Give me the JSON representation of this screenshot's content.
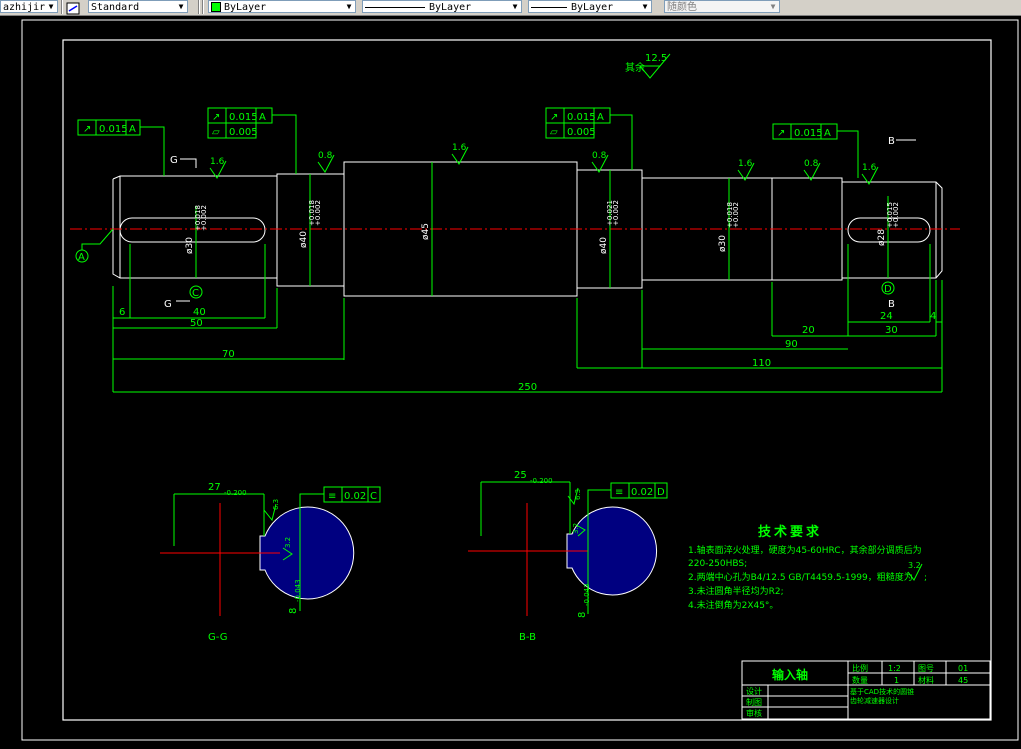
{
  "toolbar": {
    "text_style": "azhijir",
    "dim_style": "Standard",
    "layer_color": "ByLayer",
    "linetype": "ByLayer",
    "lineweight": "ByLayer",
    "plot_style": "随颜色",
    "layer_swatch_color": "#00ff00"
  },
  "drawing": {
    "surface_finish_note": "其余",
    "surface_finish_value": "12.5",
    "shaft": {
      "tolerance_frames": [
        {
          "symbol": "↗",
          "value": "0.015",
          "datum": "A"
        },
        {
          "symbol": "↗",
          "value": "0.015",
          "datum": "A"
        },
        {
          "symbol": "▱",
          "value": "0.005",
          "datum": ""
        },
        {
          "symbol": "↗",
          "value": "0.015",
          "datum": "A"
        },
        {
          "symbol": "▱",
          "value": "0.005",
          "datum": ""
        },
        {
          "symbol": "↗",
          "value": "0.015",
          "datum": "A"
        }
      ],
      "roughness_marks": [
        "1.6",
        "0.8",
        "1.6",
        "0.8",
        "1.6",
        "0.8",
        "1.6"
      ],
      "diameters": [
        "ø30",
        "ø40",
        "ø45",
        "ø40",
        "ø30",
        "ø28"
      ],
      "diameter_tolerances": [
        "+0.018\n+0.002",
        "+0.018\n+0.002",
        "",
        "+0.021\n+0.002",
        "+0.018\n+0.002",
        "+0.015\n+0.002"
      ],
      "section_labels": {
        "G": "G",
        "B": "B"
      },
      "datum_labels": [
        "A",
        "C",
        "D"
      ],
      "dimensions": [
        "6",
        "40",
        "50",
        "70",
        "250",
        "110",
        "90",
        "20",
        "24",
        "30",
        "4"
      ]
    },
    "sections": [
      {
        "label": "G-G",
        "width": "27",
        "width_tol": "-0.200",
        "key_depth": "8",
        "key_tol": "-0.043",
        "tol_value": "0.02",
        "tol_datum": "C",
        "rough1": "6.3",
        "rough2": "3.2"
      },
      {
        "label": "B-B",
        "width": "25",
        "width_tol": "-0.200",
        "key_depth": "8",
        "key_tol": "-0.043",
        "tol_value": "0.02",
        "tol_datum": "D",
        "rough1": "6.3",
        "rough2": "3.2"
      }
    ],
    "tech_requirements": {
      "title": "技术要求",
      "items": [
        "1.轴表面淬火处理，硬度为45-60HRC，其余部分调质后为",
        "220-250HBS;",
        "2.两端中心孔为B4/12.5 GB/T4459.5-1999，粗糙度为",
        "3.未注圆角半径均为R2;",
        "4.未注倒角为2X45°。"
      ],
      "roughness_mark": "3.2"
    },
    "title_block": {
      "part_name": "输入轴",
      "scale_label": "比例",
      "scale_value": "1:2",
      "qty_label": "数量",
      "qty_value": "1",
      "drawing_no_label": "图号",
      "drawing_no_value": "01",
      "material_label": "材料",
      "material_value": "45",
      "design_label": "设计",
      "drafting_label": "制图",
      "review_label": "审核",
      "project": "基于CAD技术的圆锥齿轮减速器设计"
    }
  }
}
